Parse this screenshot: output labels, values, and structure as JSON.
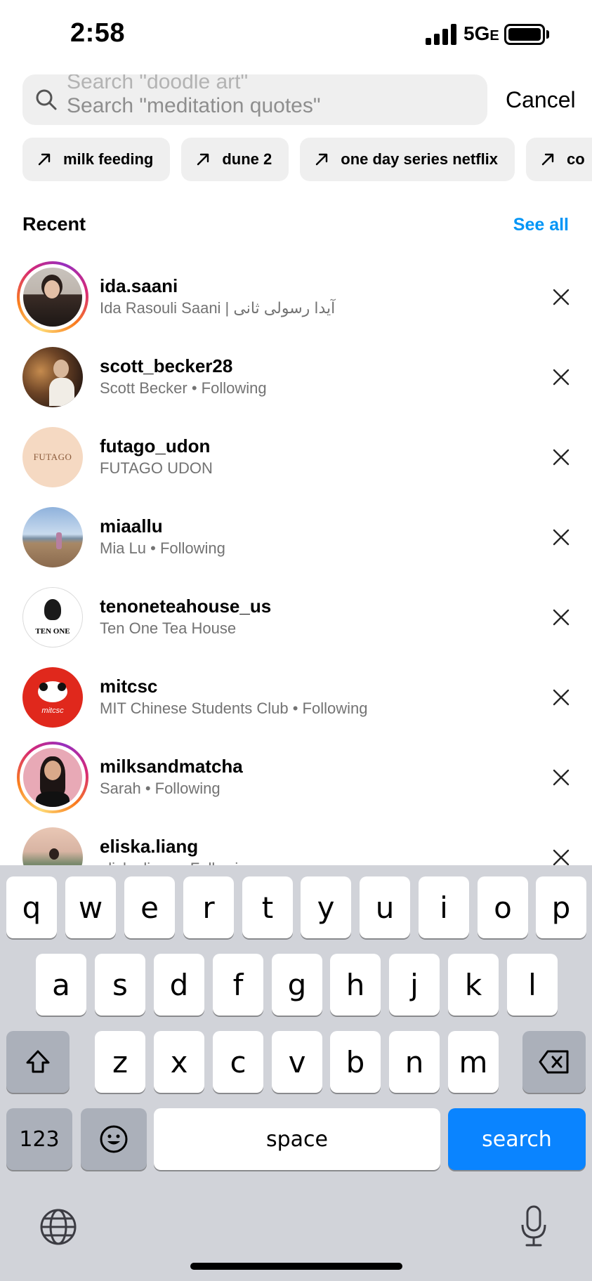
{
  "status_bar": {
    "time": "2:58",
    "network": "5G",
    "network_suffix": "E"
  },
  "search": {
    "placeholder_previous": "Search \"doodle art\"",
    "placeholder": "Search \"meditation quotes\"",
    "cancel_label": "Cancel"
  },
  "suggestions": [
    {
      "label": "milk feeding"
    },
    {
      "label": "dune 2"
    },
    {
      "label": "one day series netflix"
    },
    {
      "label": "co"
    }
  ],
  "recent": {
    "title": "Recent",
    "see_all_label": "See all",
    "items": [
      {
        "username": "ida.saani",
        "subtitle": "Ida Rasouli Saani | آیدا رسولی ثانی",
        "story_ring": true
      },
      {
        "username": "scott_becker28",
        "subtitle": "Scott Becker • Following",
        "story_ring": false
      },
      {
        "username": "futago_udon",
        "subtitle": "FUTAGO UDON",
        "story_ring": false,
        "avatar_text": "FUTAGO"
      },
      {
        "username": "miaallu",
        "subtitle": "Mia Lu • Following",
        "story_ring": false
      },
      {
        "username": "tenoneteahouse_us",
        "subtitle": "Ten One Tea House",
        "story_ring": false,
        "avatar_text": "TEN ONE"
      },
      {
        "username": "mitcsc",
        "subtitle": "MIT Chinese Students Club • Following",
        "story_ring": false,
        "avatar_text": "mitcsc"
      },
      {
        "username": "milksandmatcha",
        "subtitle": "Sarah • Following",
        "story_ring": true
      },
      {
        "username": "eliska.liang",
        "subtitle": "eliska.liang • Following",
        "story_ring": false
      }
    ]
  },
  "keyboard": {
    "row1": [
      "q",
      "w",
      "e",
      "r",
      "t",
      "y",
      "u",
      "i",
      "o",
      "p"
    ],
    "row2": [
      "a",
      "s",
      "d",
      "f",
      "g",
      "h",
      "j",
      "k",
      "l"
    ],
    "row3": [
      "z",
      "x",
      "c",
      "v",
      "b",
      "n",
      "m"
    ],
    "numbers_label": "123",
    "space_label": "space",
    "return_label": "search"
  },
  "colors": {
    "accent_link": "#0095f6",
    "search_key": "#0a84ff",
    "keyboard_bg": "#d1d3d9"
  }
}
